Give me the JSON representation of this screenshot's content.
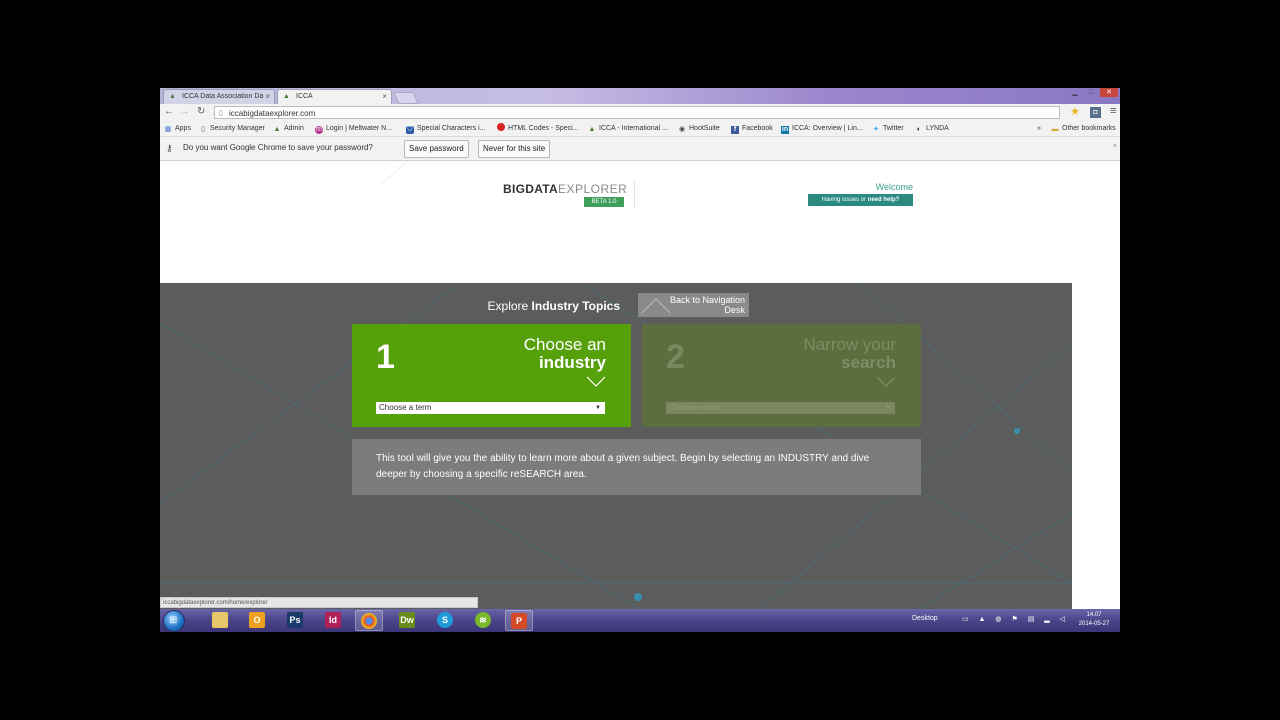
{
  "browser": {
    "tabs": [
      {
        "label": "ICCA Data Association Da",
        "active": false
      },
      {
        "label": "ICCA",
        "active": true
      }
    ],
    "url": "iccabigdataexplorer.com",
    "bookmarks": [
      {
        "label": "Apps",
        "icon": "apps-icon"
      },
      {
        "label": "Security Manager",
        "icon": "page-icon"
      },
      {
        "label": "Admin",
        "icon": "icca-icon"
      },
      {
        "label": "Login | Meltwater N...",
        "icon": "meltwater-icon"
      },
      {
        "label": "Special Characters i...",
        "icon": "shield-icon"
      },
      {
        "label": "HTML Codes - Speci...",
        "icon": "red-dot-icon"
      },
      {
        "label": "ICCA - International ...",
        "icon": "icca-icon"
      },
      {
        "label": "HootSuite",
        "icon": "owl-icon"
      },
      {
        "label": "Facebook",
        "icon": "facebook-icon"
      },
      {
        "label": "ICCA: Overview | Lin...",
        "icon": "linkedin-icon"
      },
      {
        "label": "Twitter",
        "icon": "twitter-icon"
      },
      {
        "label": "LYNDA",
        "icon": "lynda-icon"
      }
    ],
    "bookmarks_overflow": "»",
    "other_bookmarks": "Other bookmarks"
  },
  "infobar": {
    "message": "Do you want Google Chrome to save your password?",
    "save_label": "Save password",
    "never_label": "Never for this site"
  },
  "site": {
    "logo_prefix": "BIGDATA",
    "logo_suffix": "EXPLORER",
    "beta": "BETA 1.0",
    "welcome": "Welcome",
    "help_prefix": "Having issues or ",
    "help_link": "need help?",
    "explore_label": "Explore ",
    "explore_bold": "Industry Topics",
    "back_label": "Back to Navigation Desk",
    "card1": {
      "number": "1",
      "line1": "Choose an",
      "line2": "industry",
      "select_value": "Choose a term"
    },
    "card2": {
      "number": "2",
      "line1": "Narrow your",
      "line2": "search",
      "select_value": "Choose a term"
    },
    "info_text": "This tool will give you the ability to learn more about a given subject. Begin by selecting an INDUSTRY and dive deeper by choosing a specific reSEARCH area."
  },
  "status_url": "iccabigdataexplorer.com/home/explore/",
  "taskbar": {
    "apps": [
      {
        "name": "explorer",
        "label": "",
        "color": "#e8c66a"
      },
      {
        "name": "outlook",
        "label": "",
        "color": "#f0a020"
      },
      {
        "name": "photoshop",
        "label": "Ps",
        "color": "#1a3a6a"
      },
      {
        "name": "indesign",
        "label": "Id",
        "color": "#b0215a"
      },
      {
        "name": "chrome",
        "label": "",
        "color": "#e04a2a"
      },
      {
        "name": "dreamweaver",
        "label": "Dw",
        "color": "#6a8a1a"
      },
      {
        "name": "skype",
        "label": "S",
        "color": "#1e9ad8"
      },
      {
        "name": "spotify",
        "label": "",
        "color": "#7ab82a"
      },
      {
        "name": "powerpoint",
        "label": "P",
        "color": "#d24a26"
      }
    ],
    "desktop_label": "Desktop",
    "time": "14.07",
    "date": "2014-05-27"
  },
  "colors": {
    "green": "#56a00c",
    "dark_panel": "#5c5c5c",
    "teal": "#2a8a82"
  }
}
